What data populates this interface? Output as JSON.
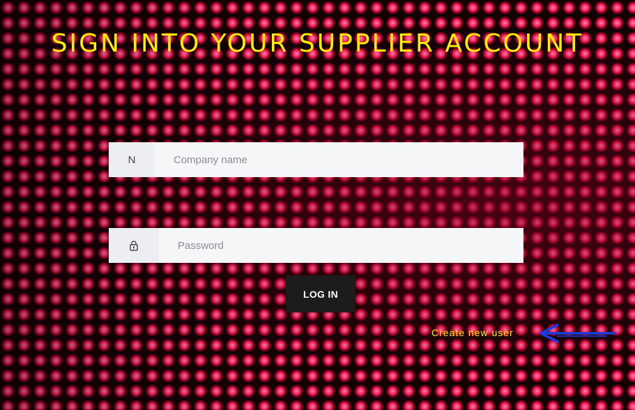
{
  "title": "SIGN INTO YOUR SUPPLIER ACCOUNT",
  "company_field": {
    "addon_text": "N",
    "placeholder": "Company name",
    "value": ""
  },
  "password_field": {
    "addon_icon": "lock-icon",
    "placeholder": "Password",
    "value": ""
  },
  "login_button": {
    "label": "LOG IN"
  },
  "create_user_link": {
    "label": "Create new user"
  },
  "annotation_arrow": {
    "icon": "arrow-left-icon",
    "color": "#1a3de0"
  },
  "colors": {
    "title": "#ffee00",
    "link": "#ffee00",
    "button_bg": "#1c1c1c",
    "input_bg": "#f5f6f8"
  }
}
